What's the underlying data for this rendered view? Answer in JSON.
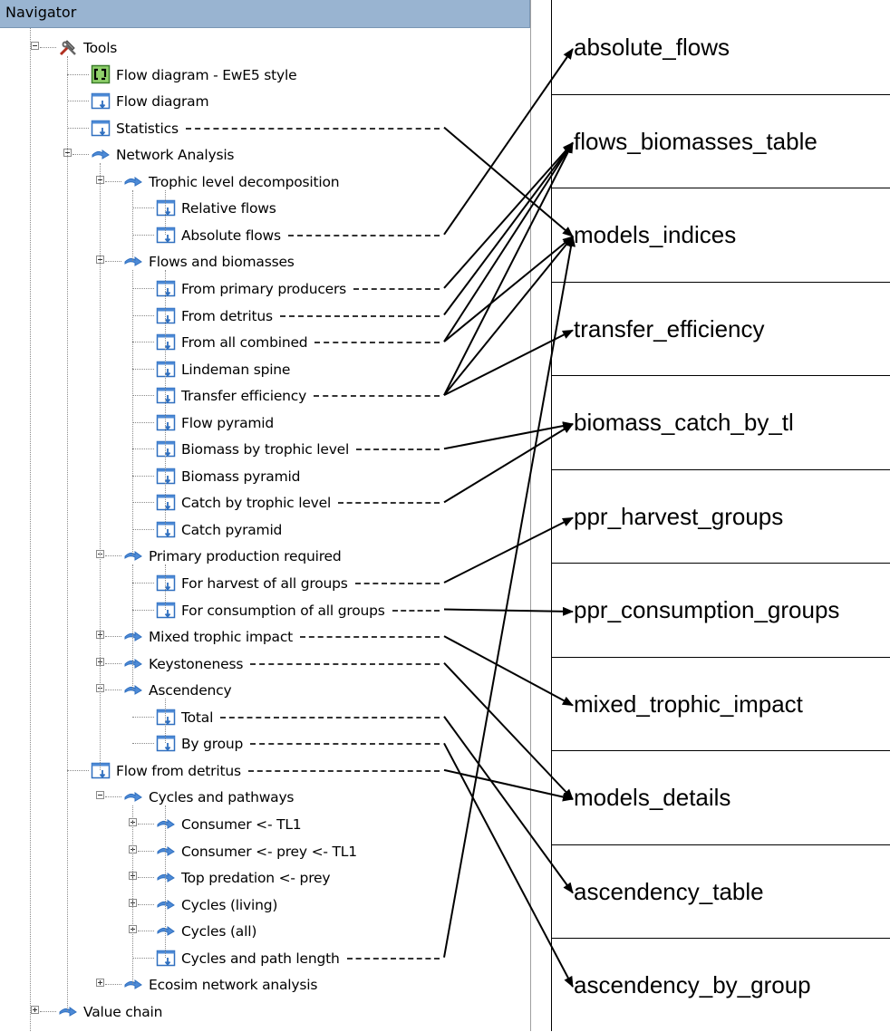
{
  "navigator": {
    "title": "Navigator",
    "items": [
      {
        "label": "Tools",
        "icon": "tools-icon",
        "expander": "minus"
      },
      {
        "label": "Flow diagram - EwE5 style",
        "icon": "flow-diagram-ewe5-icon"
      },
      {
        "label": "Flow diagram",
        "icon": "form-icon"
      },
      {
        "label": "Statistics",
        "icon": "form-icon"
      },
      {
        "label": "Network Analysis",
        "icon": "arrow-icon",
        "expander": "minus"
      },
      {
        "label": "Trophic level decomposition",
        "icon": "arrow-icon",
        "expander": "minus"
      },
      {
        "label": "Relative flows",
        "icon": "form-icon"
      },
      {
        "label": "Absolute flows",
        "icon": "form-icon"
      },
      {
        "label": "Flows and biomasses",
        "icon": "arrow-icon",
        "expander": "minus"
      },
      {
        "label": "From primary producers",
        "icon": "form-icon"
      },
      {
        "label": "From detritus",
        "icon": "form-icon"
      },
      {
        "label": "From all combined",
        "icon": "form-icon"
      },
      {
        "label": "Lindeman spine",
        "icon": "form-icon"
      },
      {
        "label": "Transfer efficiency",
        "icon": "form-icon"
      },
      {
        "label": "Flow pyramid",
        "icon": "form-icon"
      },
      {
        "label": "Biomass by trophic level",
        "icon": "form-icon"
      },
      {
        "label": "Biomass pyramid",
        "icon": "form-icon"
      },
      {
        "label": "Catch by trophic level",
        "icon": "form-icon"
      },
      {
        "label": "Catch pyramid",
        "icon": "form-icon"
      },
      {
        "label": "Primary production required",
        "icon": "arrow-icon",
        "expander": "minus"
      },
      {
        "label": "For harvest of all groups",
        "icon": "form-icon"
      },
      {
        "label": "For consumption of all groups",
        "icon": "form-icon"
      },
      {
        "label": "Mixed trophic impact",
        "icon": "arrow-icon",
        "expander": "plus"
      },
      {
        "label": "Keystoneness",
        "icon": "arrow-icon",
        "expander": "plus"
      },
      {
        "label": "Ascendency",
        "icon": "arrow-icon",
        "expander": "minus"
      },
      {
        "label": "Total",
        "icon": "form-icon"
      },
      {
        "label": "By group",
        "icon": "form-icon"
      },
      {
        "label": "Flow from detritus",
        "icon": "form-icon"
      },
      {
        "label": "Cycles and pathways",
        "icon": "arrow-icon",
        "expander": "minus"
      },
      {
        "label": "Consumer <- TL1",
        "icon": "arrow-icon",
        "expander": "plus"
      },
      {
        "label": "Consumer <- prey <- TL1",
        "icon": "arrow-icon",
        "expander": "plus"
      },
      {
        "label": "Top predation <- prey",
        "icon": "arrow-icon",
        "expander": "plus"
      },
      {
        "label": "Cycles (living)",
        "icon": "arrow-icon",
        "expander": "plus"
      },
      {
        "label": "Cycles (all)",
        "icon": "arrow-icon",
        "expander": "plus"
      },
      {
        "label": "Cycles and path length",
        "icon": "form-icon"
      },
      {
        "label": "Ecosim network analysis",
        "icon": "arrow-icon",
        "expander": "plus"
      },
      {
        "label": "Value chain",
        "icon": "arrow-icon",
        "expander": "plus"
      }
    ]
  },
  "tables": [
    "absolute_flows",
    "flows_biomasses_table",
    "models_indices",
    "transfer_efficiency",
    "biomass_catch_by_tl",
    "ppr_harvest_groups",
    "ppr_consumption_groups",
    "mixed_trophic_impact",
    "models_details",
    "ascendency_table",
    "ascendency_by_group"
  ],
  "links": [
    {
      "from": "Statistics",
      "to": "models_indices"
    },
    {
      "from": "Absolute flows",
      "to": "absolute_flows"
    },
    {
      "from": "From primary producers",
      "to": "flows_biomasses_table"
    },
    {
      "from": "From detritus",
      "to": "flows_biomasses_table"
    },
    {
      "from": "From all combined",
      "to": "flows_biomasses_table"
    },
    {
      "from": "From all combined",
      "to": "models_indices"
    },
    {
      "from": "Transfer efficiency",
      "to": "flows_biomasses_table"
    },
    {
      "from": "Transfer efficiency",
      "to": "transfer_efficiency"
    },
    {
      "from": "Transfer efficiency",
      "to": "models_indices"
    },
    {
      "from": "Biomass by trophic level",
      "to": "biomass_catch_by_tl"
    },
    {
      "from": "Catch by trophic level",
      "to": "biomass_catch_by_tl"
    },
    {
      "from": "For harvest of all groups",
      "to": "ppr_harvest_groups"
    },
    {
      "from": "For consumption of all groups",
      "to": "ppr_consumption_groups"
    },
    {
      "from": "Mixed trophic impact",
      "to": "mixed_trophic_impact"
    },
    {
      "from": "Keystoneness",
      "to": "models_details"
    },
    {
      "from": "Total",
      "to": "ascendency_table"
    },
    {
      "from": "By group",
      "to": "ascendency_by_group"
    },
    {
      "from": "Flow from detritus",
      "to": "models_details"
    },
    {
      "from": "Cycles and path length",
      "to": "models_indices"
    }
  ]
}
